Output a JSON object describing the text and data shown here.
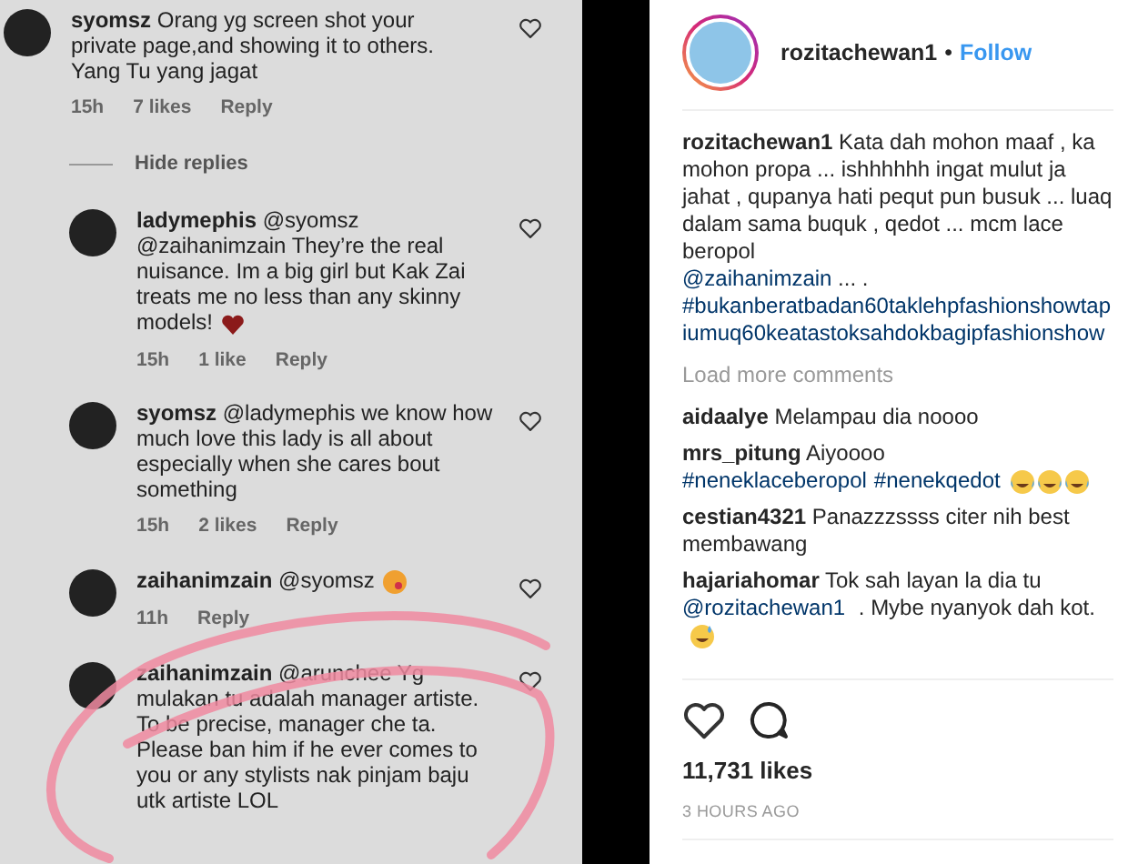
{
  "left_panel": {
    "comments": [
      {
        "kind": "top",
        "username": "syomsz",
        "text": "Orang yg screen shot your private page,and showing it to others. Yang Tu yang jagat",
        "time": "15h",
        "likes": "7 likes",
        "reply": "Reply"
      },
      {
        "kind": "toggle",
        "label": "Hide replies"
      },
      {
        "kind": "reply",
        "username": "ladymephis",
        "text": "@syomsz @zaihanimzain They’re the real nuisance. Im a big girl but Kak Zai treats me no less than any skinny models!",
        "trailing": {
          "kind": "heart"
        },
        "time": "15h",
        "likes": "1 like",
        "reply": "Reply"
      },
      {
        "kind": "reply",
        "username": "syomsz",
        "text": "@ladymephis we know how much love this lady is all about especially when she cares bout something",
        "time": "15h",
        "likes": "2 likes",
        "reply": "Reply"
      },
      {
        "kind": "reply",
        "username": "zaihanimzain",
        "text": "@syomsz",
        "trailing": {
          "kind": "kiss"
        },
        "time": "11h",
        "reply": "Reply"
      },
      {
        "kind": "reply",
        "username": "zaihanimzain",
        "text": "@arunchee Yg mulakan tu adalah manager artiste. To be precise, manager che ta. Please ban him if he ever comes to you or any stylists nak pinjam baju utk artiste LOL"
      }
    ]
  },
  "post": {
    "username": "rozitachewan1",
    "separator": "•",
    "follow": "Follow",
    "caption": {
      "username": "rozitachewan1",
      "text": "Kata dah mohon maaf , ka mohon propa ... ishhhhhh ingat mulut ja jahat , qupanya hati pequt pun busuk ... luaq dalam sama buquk , qedot ... mcm lace beropol",
      "mention": "@zaihanimzain",
      "after_mention": " ... .",
      "hashtag": "#bukanberatbadan60taklehpfashionshowtapiumuq60keatastoksahdokbagipfashionshow"
    },
    "load_more": "Load more comments",
    "comments": [
      {
        "username": "aidaalye",
        "parts": [
          {
            "kind": "text",
            "text": "Melampau dia noooo"
          }
        ]
      },
      {
        "username": "mrs_pitung",
        "parts": [
          {
            "kind": "text",
            "text": "Aiyoooo "
          },
          {
            "kind": "link",
            "text": "#neneklaceberopol"
          },
          {
            "kind": "link",
            "text": "#nenekqedot"
          },
          {
            "kind": "tears-of-joy"
          },
          {
            "kind": "tears-of-joy"
          },
          {
            "kind": "tears-of-joy"
          }
        ]
      },
      {
        "username": "cestian4321",
        "parts": [
          {
            "kind": "text",
            "text": "Panazzzssss citer nih best membawang"
          }
        ]
      },
      {
        "username": "hajariahomar",
        "parts": [
          {
            "kind": "text",
            "text": "Tok sah layan la dia tu "
          },
          {
            "kind": "link",
            "text": "@rozitachewan1"
          },
          {
            "kind": "text",
            "text": " . Mybe nyanyok dah kot."
          },
          {
            "kind": "sweat-smile"
          }
        ]
      }
    ],
    "likes": "11,731 likes",
    "time": "3 HOURS AGO"
  }
}
